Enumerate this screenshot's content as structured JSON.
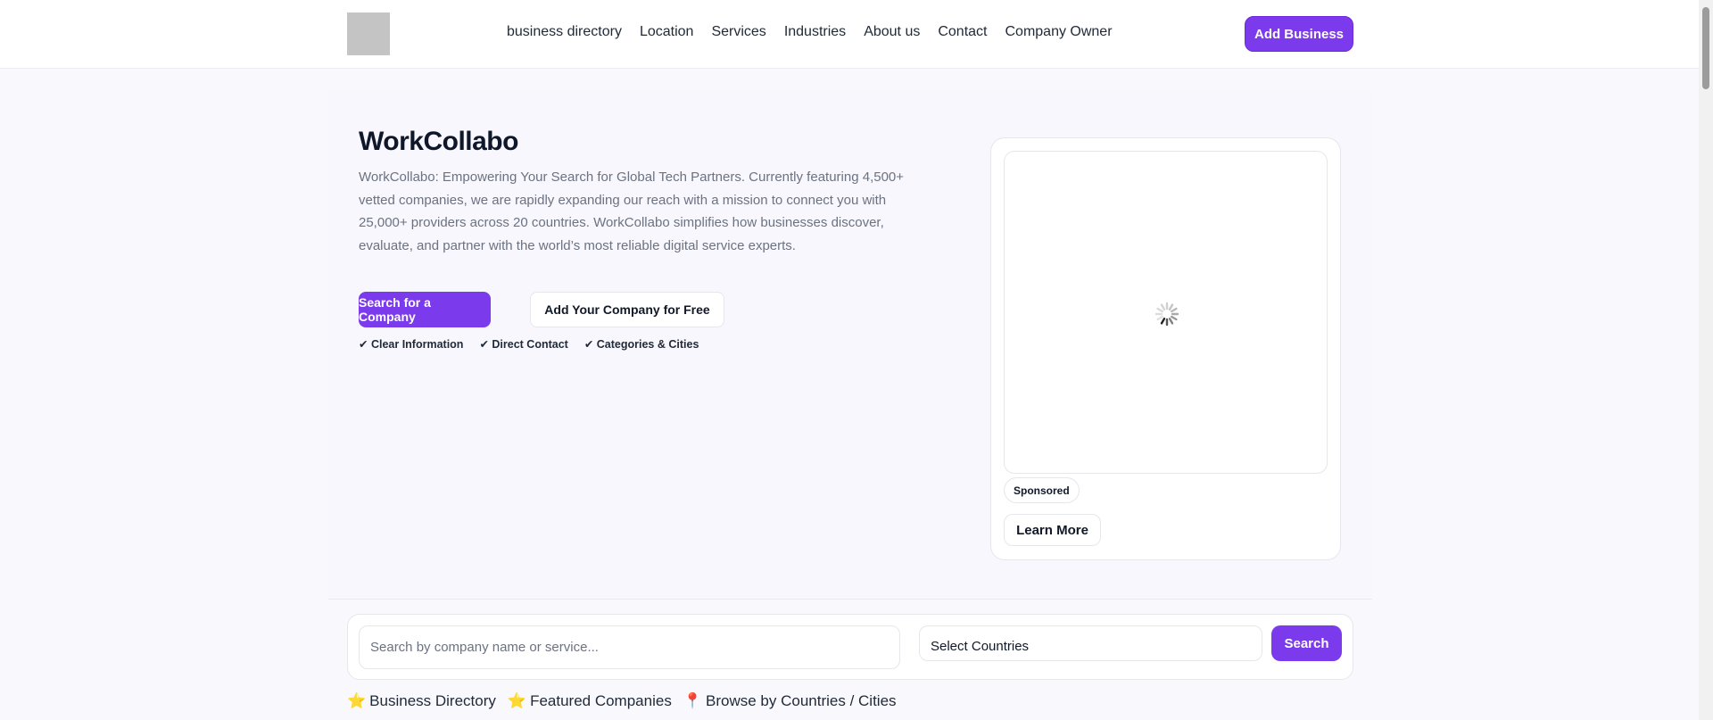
{
  "header": {
    "logo_alt": "",
    "nav": [
      {
        "label": "business directory"
      },
      {
        "label": "Location"
      },
      {
        "label": "Services"
      },
      {
        "label": "Industries"
      },
      {
        "label": "About us"
      },
      {
        "label": "Contact"
      },
      {
        "label": "Company Owner"
      }
    ],
    "add_business_label": "Add Business"
  },
  "hero": {
    "title": "WorkCollabo",
    "description": "WorkCollabo: Empowering Your Search for Global Tech Partners. Currently featuring 4,500+ vetted companies, we are rapidly expanding our reach with a mission to connect you with 25,000+ providers across 20 countries. WorkCollabo simplifies how businesses discover, evaluate, and partner with the world’s most reliable digital service experts.",
    "primary_button": "Search for a Company",
    "secondary_button": "Add Your Company for Free",
    "features": [
      "✔ Clear Information",
      "✔ Direct Contact",
      "✔ Categories & Cities"
    ]
  },
  "sponsored_card": {
    "badge": "Sponsored",
    "cta": "Learn More"
  },
  "search": {
    "placeholder": "Search by company name or service...",
    "country_select": "Select Countries",
    "button": "Search"
  },
  "bottom_links": [
    {
      "icon": "⭐",
      "label": "Business Directory"
    },
    {
      "icon": "⭐",
      "label": "Featured Companies"
    },
    {
      "icon": "📍",
      "label": "Browse by Countries / Cities"
    }
  ],
  "colors": {
    "accent": "#7c3aed",
    "background": "#f9f9fd",
    "text": "#111827"
  }
}
